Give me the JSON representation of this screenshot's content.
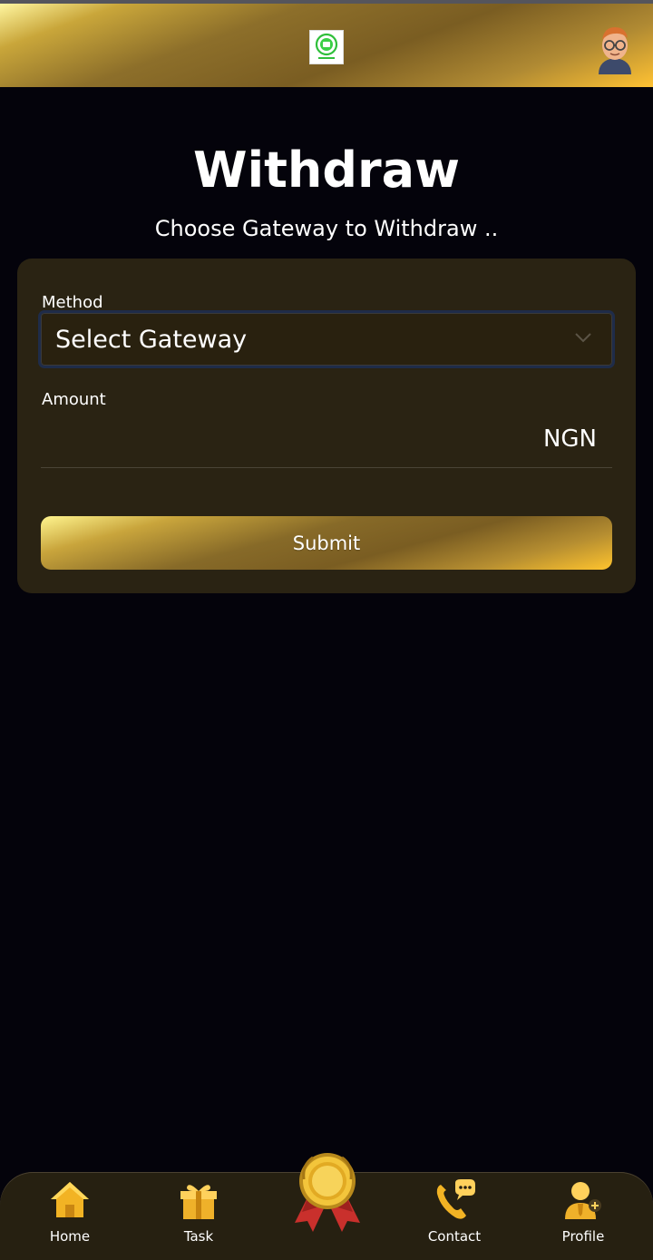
{
  "page": {
    "title": "Withdraw",
    "subtitle": "Choose Gateway to Withdraw .."
  },
  "form": {
    "method_label": "Method",
    "method_selected": "Select Gateway",
    "method_placeholder": "Select Gateway",
    "amount_label": "Amount",
    "amount_value": "",
    "currency": "NGN",
    "submit_label": "Submit"
  },
  "nav": {
    "items": [
      {
        "label": "Home",
        "icon": "home-icon"
      },
      {
        "label": "Task",
        "icon": "gift-icon"
      },
      {
        "label": "",
        "icon": "medal-icon"
      },
      {
        "label": "Contact",
        "icon": "phone-chat-icon"
      },
      {
        "label": "Profile",
        "icon": "profile-add-icon"
      }
    ]
  },
  "colors": {
    "background": "#04030b",
    "card": "#2a2313",
    "gold": "#c9a63a",
    "gold_light": "#fff6a0",
    "gold_bright": "#ffc233"
  }
}
